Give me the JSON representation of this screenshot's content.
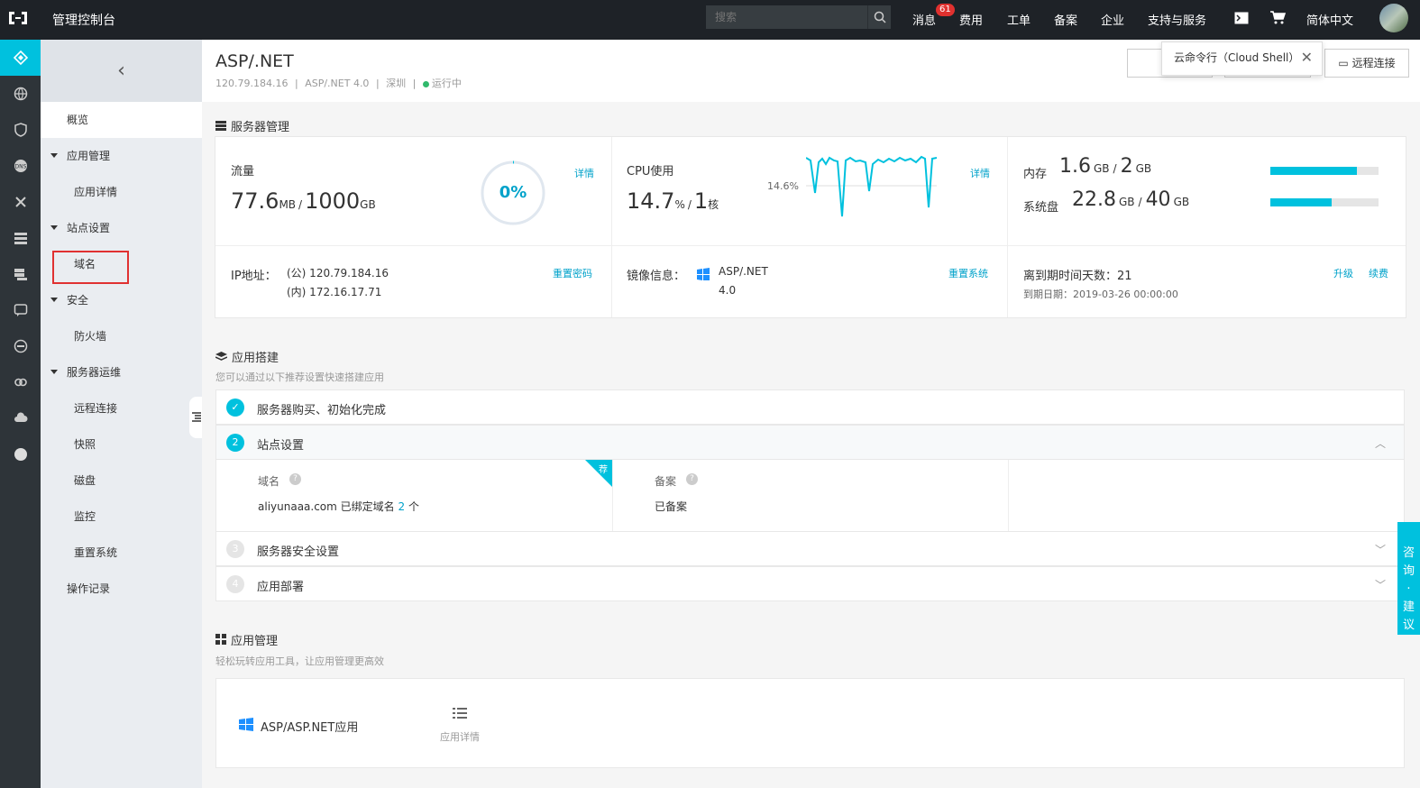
{
  "topbar": {
    "brand": "管理控制台",
    "search_placeholder": "搜索",
    "nav": [
      "消息",
      "费用",
      "工单",
      "备案",
      "企业",
      "支持与服务",
      "简体中文"
    ],
    "message_badge": "61"
  },
  "tooltip": {
    "text": "云命令行（Cloud Shell）"
  },
  "sidebar": {
    "items": [
      "概览",
      "应用管理",
      "应用详情",
      "站点设置",
      "域名",
      "安全",
      "防火墙",
      "服务器运维",
      "远程连接",
      "快照",
      "磁盘",
      "监控",
      "重置系统",
      "操作记录"
    ]
  },
  "header": {
    "title": "ASP/.NET",
    "ip": "120.79.184.16",
    "image": "ASP/.NET 4.0",
    "region": "深圳",
    "status": "运行中",
    "remote_button": "远程连接",
    "sep": "|"
  },
  "server_mgmt": {
    "title": "服务器管理",
    "traffic_label": "流量",
    "traffic_used": "77.6",
    "traffic_used_unit": "MB",
    "traffic_total": "1000",
    "traffic_total_unit": "GB",
    "traffic_pct": "0%",
    "detail_link": "详情",
    "cpu_label": "CPU使用",
    "cpu_value": "14.7",
    "cpu_unit": "%",
    "cpu_cores": "1",
    "cpu_core_unit": "核",
    "cpu_chart_label": "14.6%",
    "mem_label": "内存",
    "mem_used": "1.6",
    "mem_total": "2",
    "disk_label": "系统盘",
    "disk_used": "22.8",
    "disk_total": "40",
    "gb": "GB",
    "slash": "/",
    "mem_fraction": 0.8,
    "disk_fraction": 0.57,
    "ip_label": "IP地址：",
    "ip_public": "(公) 120.79.184.16",
    "ip_private": "(内) 172.16.17.71",
    "reset_pwd": "重置密码",
    "image_label": "镜像信息：",
    "image_name": "ASP/.NET",
    "image_ver": "4.0",
    "reset_sys": "重置系统",
    "expire_label": "离到期时间天数：21",
    "expire_date": "到期日期：2019-03-26 00:00:00",
    "upgrade": "升级",
    "renew": "续费"
  },
  "app_build": {
    "title": "应用搭建",
    "desc": "您可以通过以下推荐设置快速搭建应用",
    "steps": [
      {
        "num": "✓",
        "label": "服务器购买、初始化完成"
      },
      {
        "num": "2",
        "label": "站点设置"
      },
      {
        "num": "3",
        "label": "服务器安全设置"
      },
      {
        "num": "4",
        "label": "应用部署"
      }
    ],
    "domain_label": "域名",
    "domain_value": "aliyunaaa.com 已绑定域名",
    "domain_count": "2",
    "domain_unit": "个",
    "recommend": "荐",
    "record_label": "备案",
    "record_value": "已备案"
  },
  "app_mgmt": {
    "title": "应用管理",
    "desc": "轻松玩转应用工具，让应用管理更高效",
    "app_name": "ASP/ASP.NET应用",
    "app_detail": "应用详情"
  },
  "feedback": {
    "chars": [
      "咨",
      "询",
      "·",
      "建",
      "议"
    ]
  }
}
